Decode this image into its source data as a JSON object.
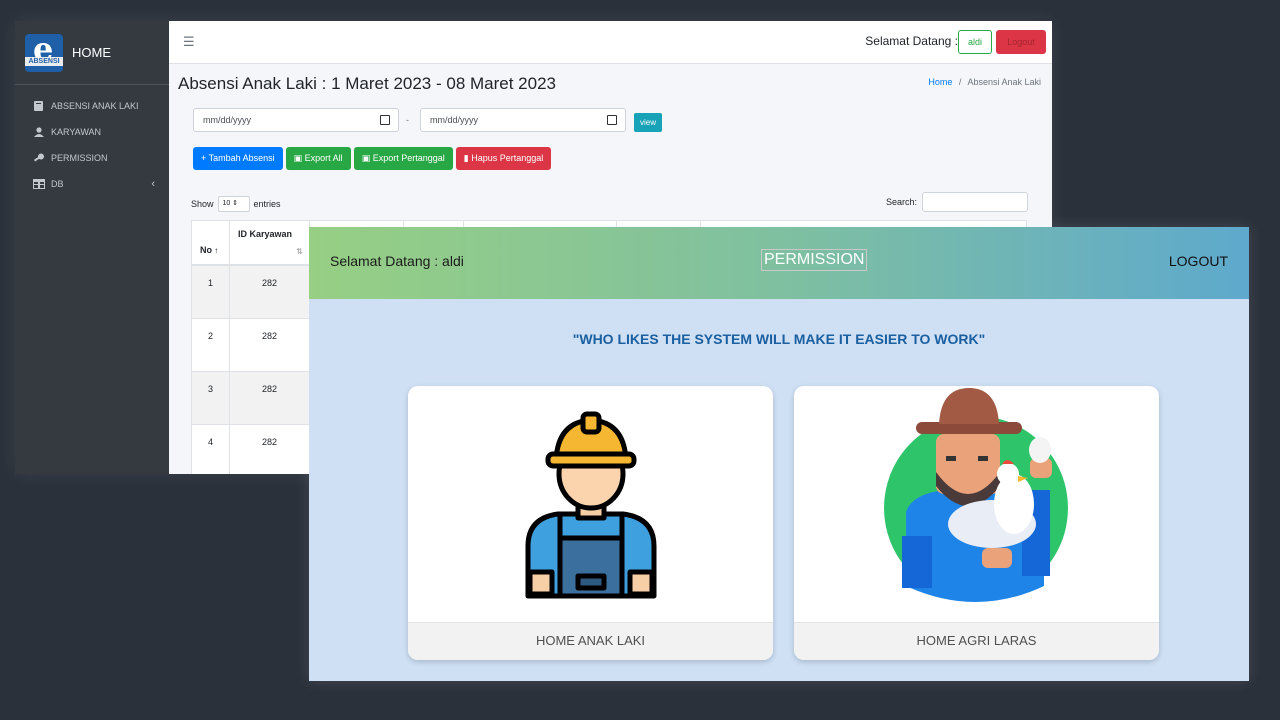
{
  "admin": {
    "brand": {
      "logo_text": "e",
      "logo_band": "ABSENSI",
      "title": "HOME"
    },
    "sidebar": {
      "items": [
        {
          "label": "ABSENSI ANAK LAKI",
          "icon": "book-icon"
        },
        {
          "label": "KARYAWAN",
          "icon": "user-icon"
        },
        {
          "label": "PERMISSION",
          "icon": "key-icon"
        },
        {
          "label": "DB",
          "icon": "table-icon"
        }
      ]
    },
    "topbar": {
      "welcome": "Selamat Datang :",
      "user": "aldi",
      "logout": "Logout"
    },
    "page_title": "Absensi Anak Laki : 1 Maret 2023 - 08 Maret 2023",
    "breadcrumb": {
      "home": "Home",
      "separator": "/",
      "current": "Absensi Anak Laki"
    },
    "filter": {
      "start_placeholder": "mm/dd/yyyy",
      "dash": "-",
      "end_placeholder": "mm/dd/yyyy",
      "view": "view"
    },
    "actions": {
      "add": "+ Tambah Absensi",
      "export_all": "Export All",
      "export_date": "Export Pertanggal",
      "delete_date": "Hapus Pertanggal"
    },
    "table_controls": {
      "show": "Show",
      "entries_value": "10",
      "entries": "entries",
      "search": "Search:"
    },
    "table": {
      "columns": [
        "No",
        "ID Karyawan"
      ],
      "rows": [
        {
          "no": "1",
          "id": "282"
        },
        {
          "no": "2",
          "id": "282"
        },
        {
          "no": "3",
          "id": "282"
        },
        {
          "no": "4",
          "id": "282"
        }
      ]
    }
  },
  "permission": {
    "header": {
      "welcome": "Selamat Datang : aldi",
      "title": "PERMISSION",
      "logout": "LOGOUT"
    },
    "quote": "\"WHO LIKES THE SYSTEM WILL MAKE IT EASIER TO WORK\"",
    "cards": [
      {
        "label": "HOME ANAK LAKI",
        "icon": "worker-icon"
      },
      {
        "label": "HOME AGRI LARAS",
        "icon": "farmer-icon"
      }
    ],
    "colors": {
      "header_start": "#97cf84",
      "header_end": "#5ea9cd",
      "background": "#cfe0f5",
      "quote": "#1a5fa0"
    }
  }
}
